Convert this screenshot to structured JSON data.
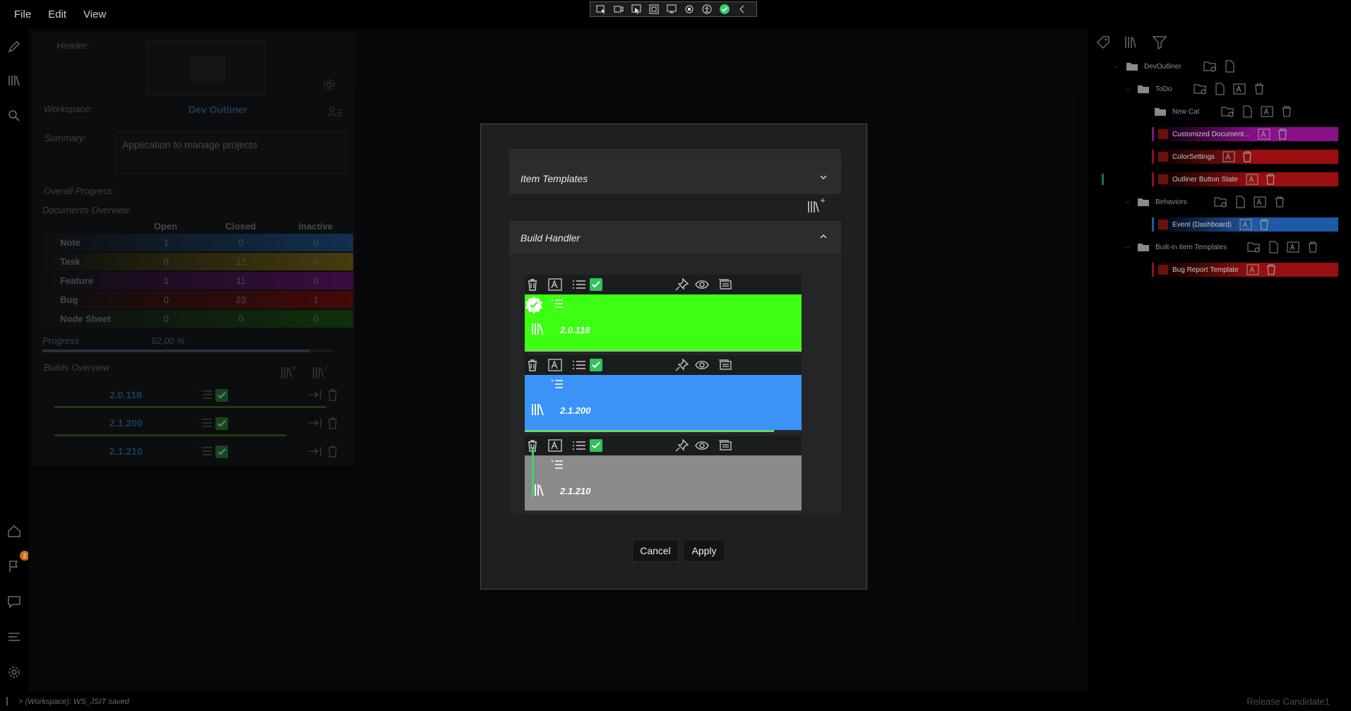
{
  "menu": [
    "File",
    "Edit",
    "View"
  ],
  "workspace_panel": {
    "header_label": "Header:",
    "workspace_label": "Workspace:",
    "workspace_value": "Dev Outliner",
    "summary_label": "Summary:",
    "summary_value": "Application to manage projects",
    "overall_progress_label": "Overall Progress:",
    "documents_overview_label": "Documents Overview",
    "doc_columns": [
      "Open",
      "Closed",
      "Inactive"
    ],
    "doc_rows": [
      {
        "name": "Note",
        "open": "1",
        "closed": "0",
        "inactive": "0",
        "color": "#1e4a7a"
      },
      {
        "name": "Task",
        "open": "0",
        "closed": "12",
        "inactive": "0",
        "color": "#6e5e12"
      },
      {
        "name": "Feature",
        "open": "1",
        "closed": "11",
        "inactive": "0",
        "color": "#5a1466"
      },
      {
        "name": "Bug",
        "open": "0",
        "closed": "23",
        "inactive": "1",
        "color": "#6a0e0e"
      },
      {
        "name": "Node Sheet",
        "open": "0",
        "closed": "0",
        "inactive": "0",
        "color": "#1a4a12"
      }
    ],
    "progress_label": "Progress",
    "progress_value": "92,00 %",
    "progress_fraction": 0.92,
    "builds_overview_label": "Builds Overview",
    "builds": [
      {
        "version": "2.0.118",
        "line_fraction": 0.94
      },
      {
        "version": "2.1.200",
        "line_fraction": 0.8
      },
      {
        "version": "2.1.210",
        "line_fraction": 0.0
      }
    ]
  },
  "outline": {
    "root": "DevOutliner",
    "todo": "ToDo",
    "new_cat": "New Cat",
    "leaves_todo": [
      {
        "label": "Customized Document...",
        "color": "#8a0f8a"
      },
      {
        "label": "ColorSettings",
        "color": "#9a0f0f"
      },
      {
        "label": "Outliner Button State",
        "color": "#9a0f0f"
      }
    ],
    "behaviors": "Behaviors",
    "leaves_behaviors": [
      {
        "label": "Event (Dashboard)",
        "color": "#1e5aa8"
      }
    ],
    "templates": "Built-in Item Templates",
    "leaves_templates": [
      {
        "label": "Bug Report Template",
        "color": "#9a0f0f"
      }
    ]
  },
  "modal": {
    "item_templates_label": "Item Templates",
    "build_handler_label": "Build Handler",
    "cards": [
      {
        "version": "2.0.118",
        "color": "#3dff12",
        "progress_fraction": 1.0,
        "progress_color": "#7ad35a",
        "done": true
      },
      {
        "version": "2.1.200",
        "color": "#3b93f7",
        "progress_fraction": 0.9,
        "progress_color": "#66d86a",
        "done": false
      },
      {
        "version": "2.1.210",
        "color": "#8a8a8a",
        "progress_fraction": 0.0,
        "progress_color": "#777777",
        "done": false
      }
    ],
    "cancel_label": "Cancel",
    "apply_label": "Apply"
  },
  "status": {
    "message": "> (Workspace): WS_JSIT saved",
    "right": "Release Candidate1",
    "notification_count": "2"
  }
}
